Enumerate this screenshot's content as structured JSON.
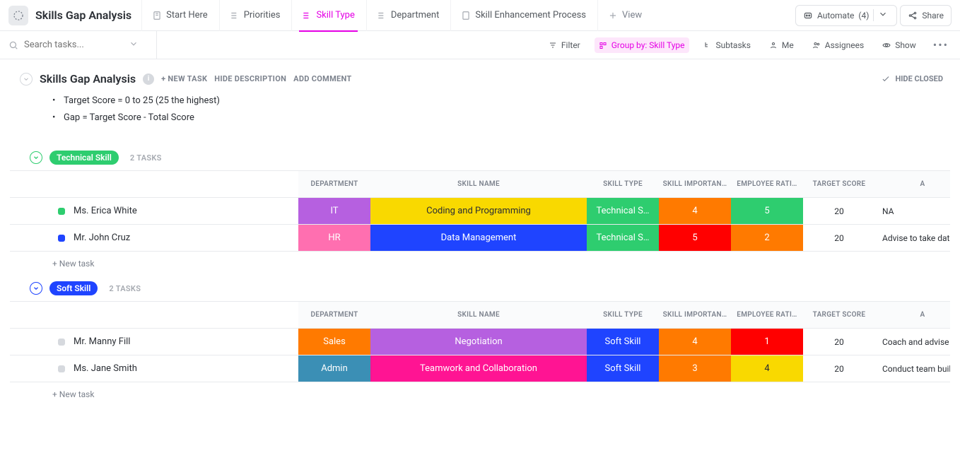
{
  "page_title": "Skills Gap Analysis",
  "tabs": {
    "start_here": "Start Here",
    "priorities": "Priorities",
    "skill_type": "Skill Type",
    "department": "Department",
    "enhancement": "Skill Enhancement Process",
    "add_view": "View"
  },
  "buttons": {
    "automate": "Automate",
    "automate_count": "(4)",
    "share": "Share"
  },
  "search": {
    "placeholder": "Search tasks..."
  },
  "filters": {
    "filter": "Filter",
    "group_by": "Group by: Skill Type",
    "subtasks": "Subtasks",
    "me": "Me",
    "assignees": "Assignees",
    "show": "Show",
    "hide_closed": "HIDE CLOSED"
  },
  "list_header": {
    "title": "Skills Gap Analysis",
    "new_task": "+ NEW TASK",
    "hide_desc": "HIDE DESCRIPTION",
    "add_comment": "ADD COMMENT"
  },
  "description": {
    "line1": "Target Score = 0 to 25 (25 the highest)",
    "line2": "Gap = Target Score - Total Score"
  },
  "columns": {
    "department": "DEPARTMENT",
    "skill_name": "SKILL NAME",
    "skill_type": "SKILL TYPE",
    "skill_importance": "SKILL IMPORTAN…",
    "employee_rating": "EMPLOYEE RATI…",
    "target_score": "TARGET SCORE",
    "action": "A"
  },
  "groups": [
    {
      "name": "Technical Skill",
      "pill_class": "green",
      "count": "2 TASKS",
      "rows": [
        {
          "name": "Ms. Erica White",
          "dot": "#2ecd6f",
          "dept": {
            "text": "IT",
            "bg": "bg-purple"
          },
          "skill": {
            "text": "Coding and Programming",
            "bg": "bg-yellow txt-dark"
          },
          "type": {
            "text": "Technical S…",
            "bg": "bg-green"
          },
          "importance": {
            "text": "4",
            "bg": "bg-orange"
          },
          "rating": {
            "text": "5",
            "bg": "bg-green"
          },
          "target": "20",
          "action": "NA"
        },
        {
          "name": "Mr. John Cruz",
          "dot": "#1f44ff",
          "dept": {
            "text": "HR",
            "bg": "bg-pink"
          },
          "skill": {
            "text": "Data Management",
            "bg": "bg-royal"
          },
          "type": {
            "text": "Technical S…",
            "bg": "bg-green"
          },
          "importance": {
            "text": "5",
            "bg": "bg-red"
          },
          "rating": {
            "text": "2",
            "bg": "bg-orange"
          },
          "target": "20",
          "action": "Advise to take data mana"
        }
      ]
    },
    {
      "name": "Soft Skill",
      "pill_class": "blue",
      "count": "2 TASKS",
      "rows": [
        {
          "name": "Mr. Manny Fill",
          "dot": "#d6d9de",
          "dept": {
            "text": "Sales",
            "bg": "bg-orange"
          },
          "skill": {
            "text": "Negotiation",
            "bg": "bg-purple"
          },
          "type": {
            "text": "Soft Skill",
            "bg": "bg-royal"
          },
          "importance": {
            "text": "4",
            "bg": "bg-orange"
          },
          "rating": {
            "text": "1",
            "bg": "bg-red"
          },
          "target": "20",
          "action": "Coach and advise to take"
        },
        {
          "name": "Ms. Jane Smith",
          "dot": "#d6d9de",
          "dept": {
            "text": "Admin",
            "bg": "bg-teal"
          },
          "skill": {
            "text": "Teamwork and Collaboration",
            "bg": "bg-magenta"
          },
          "type": {
            "text": "Soft Skill",
            "bg": "bg-royal"
          },
          "importance": {
            "text": "3",
            "bg": "bg-orange"
          },
          "rating": {
            "text": "4",
            "bg": "bg-yellow txt-dark"
          },
          "target": "20",
          "action": "Conduct team building ac"
        }
      ]
    }
  ],
  "new_task_label": "+ New task"
}
